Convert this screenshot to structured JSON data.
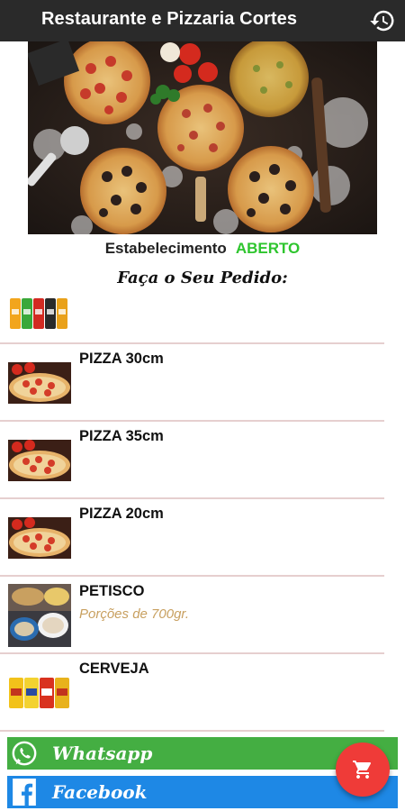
{
  "app_bar": {
    "title": "Restaurante e Pizzaria Cortes",
    "history_icon": "history-icon"
  },
  "status": {
    "label": "Estabelecimento",
    "value": "ABERTO",
    "value_color": "#2ec52e"
  },
  "headline": "Faça o Seu Pedido:",
  "menu": {
    "items": [
      {
        "name": "",
        "description": "",
        "image": "soft-drinks-image"
      },
      {
        "name": "PIZZA 30cm",
        "description": "",
        "image": "pizza-image"
      },
      {
        "name": "PIZZA 35cm",
        "description": "",
        "image": "pizza-image"
      },
      {
        "name": "PIZZA 20cm",
        "description": "",
        "image": "pizza-image"
      },
      {
        "name": "PETISCO",
        "description": "Porções de 700gr.",
        "image": "petisco-image"
      },
      {
        "name": "CERVEJA",
        "description": "",
        "image": "beer-cans-image"
      }
    ]
  },
  "social": {
    "whatsapp_label": "Whatsapp",
    "facebook_label": "Facebook",
    "whatsapp_color": "#44ae42",
    "facebook_color": "#1e88e5"
  },
  "fab": {
    "icon": "cart-icon",
    "color": "#ef3b38"
  },
  "colors": {
    "app_bar": "#2a2a2a",
    "divider": "#e6cfcf",
    "description": "#c8a060"
  }
}
